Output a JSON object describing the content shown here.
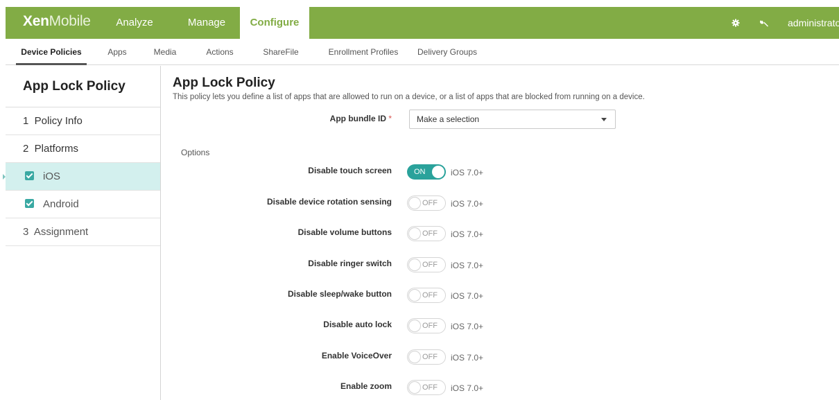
{
  "topnav": {
    "brand_bold": "Xen",
    "brand_light": "Mobile",
    "tabs": [
      {
        "label": "Analyze"
      },
      {
        "label": "Manage"
      },
      {
        "label": "Configure"
      }
    ],
    "user": "administrator",
    "icons": [
      "gear-icon",
      "wrench-icon"
    ],
    "accent_color": "#82ac45"
  },
  "subnav": {
    "tabs": [
      {
        "label": "Device Policies"
      },
      {
        "label": "Apps"
      },
      {
        "label": "Media"
      },
      {
        "label": "Actions"
      },
      {
        "label": "ShareFile"
      },
      {
        "label": "Enrollment Profiles"
      },
      {
        "label": "Delivery Groups"
      }
    ]
  },
  "sidebar": {
    "title": "App Lock Policy",
    "items": [
      {
        "label": "1  Policy Info"
      },
      {
        "label": "2  Platforms"
      },
      {
        "label": "iOS"
      },
      {
        "label": "Android"
      },
      {
        "label": "3  Assignment"
      }
    ]
  },
  "main": {
    "title": "App Lock Policy",
    "description": "This policy lets you define a list of apps that are allowed to run on a device, or a list of apps that are blocked from running on a device.",
    "bundle_label": "App bundle ID",
    "required_mark": "*",
    "bundle_value": "Make a selection",
    "options_heading": "Options",
    "options": [
      {
        "label": "Disable touch screen",
        "state": "ON",
        "version": "iOS 7.0+"
      },
      {
        "label": "Disable device rotation sensing",
        "state": "OFF",
        "version": "iOS 7.0+"
      },
      {
        "label": "Disable volume buttons",
        "state": "OFF",
        "version": "iOS 7.0+"
      },
      {
        "label": "Disable ringer switch",
        "state": "OFF",
        "version": "iOS 7.0+"
      },
      {
        "label": "Disable sleep/wake button",
        "state": "OFF",
        "version": "iOS 7.0+"
      },
      {
        "label": "Disable auto lock",
        "state": "OFF",
        "version": "iOS 7.0+"
      },
      {
        "label": "Enable VoiceOver",
        "state": "OFF",
        "version": "iOS 7.0+"
      },
      {
        "label": "Enable zoom",
        "state": "OFF",
        "version": "iOS 7.0+"
      }
    ]
  }
}
